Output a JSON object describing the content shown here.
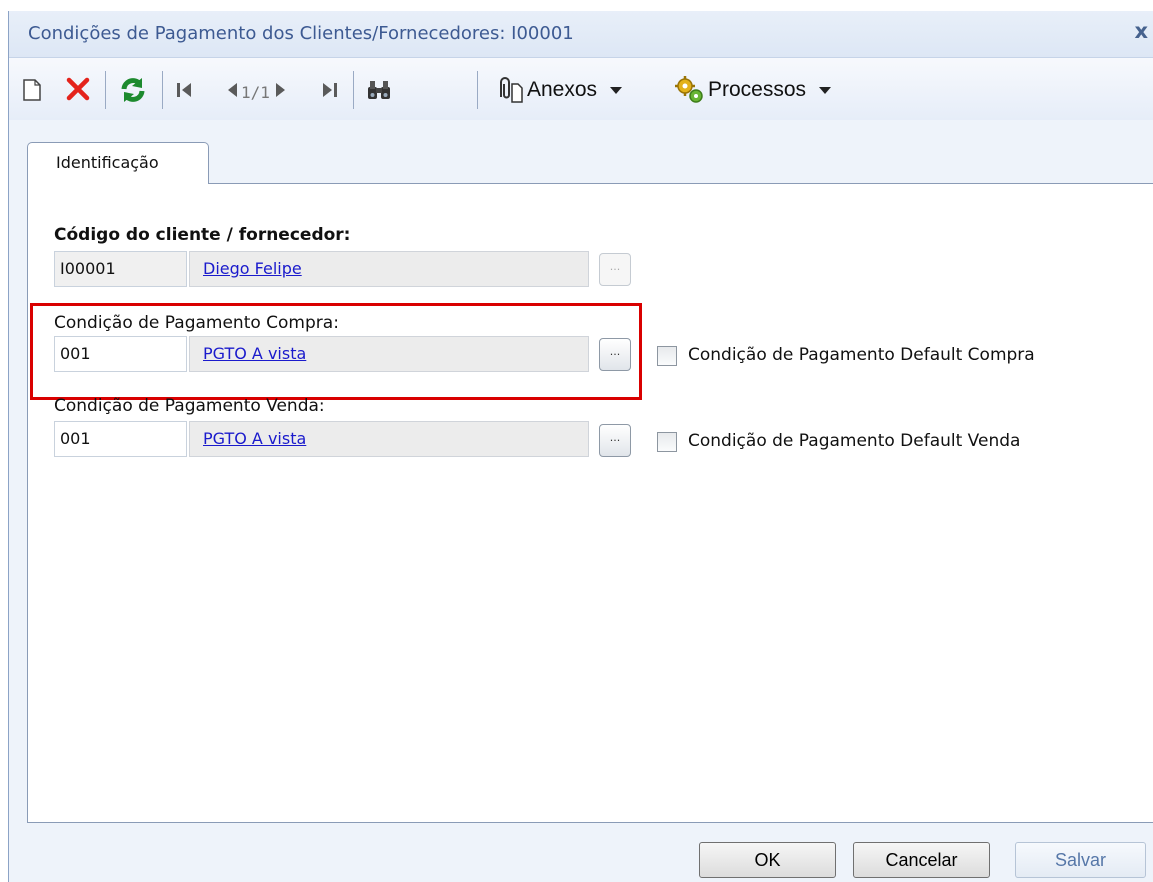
{
  "window": {
    "title": "Condições de Pagamento dos Clientes/Fornecedores: I00001",
    "close_label": "x"
  },
  "toolbar": {
    "icons": [
      "new-document-icon",
      "delete-icon",
      "refresh-icon",
      "first-record-icon",
      "previous-record-icon",
      "next-record-icon",
      "last-record-icon",
      "search-binoculars-icon",
      "paperclip-icon",
      "gear-process-icon"
    ],
    "pager": "1/1",
    "anexos_label": "Anexos",
    "processos_label": "Processos"
  },
  "tabs": [
    {
      "label": "Identificação",
      "active": true
    }
  ],
  "form": {
    "cliente": {
      "label": "Código do cliente / fornecedor:",
      "code": "I00001",
      "description": "Diego Felipe",
      "lookup_label": "..."
    },
    "compra": {
      "label": "Condição de Pagamento Compra:",
      "code": "001",
      "description": "PGTO A vista",
      "lookup_label": "...",
      "default_label": "Condição de Pagamento Default Compra",
      "default_checked": false
    },
    "venda": {
      "label": "Condição de Pagamento Venda:",
      "code": "001",
      "description": "PGTO A vista",
      "lookup_label": "...",
      "default_label": "Condição de Pagamento Default Venda",
      "default_checked": false
    }
  },
  "buttons": {
    "ok": "OK",
    "cancel": "Cancelar",
    "save": "Salvar"
  },
  "colors": {
    "highlight": "#d90000",
    "link": "#1a1acc",
    "title": "#3d5a92"
  }
}
